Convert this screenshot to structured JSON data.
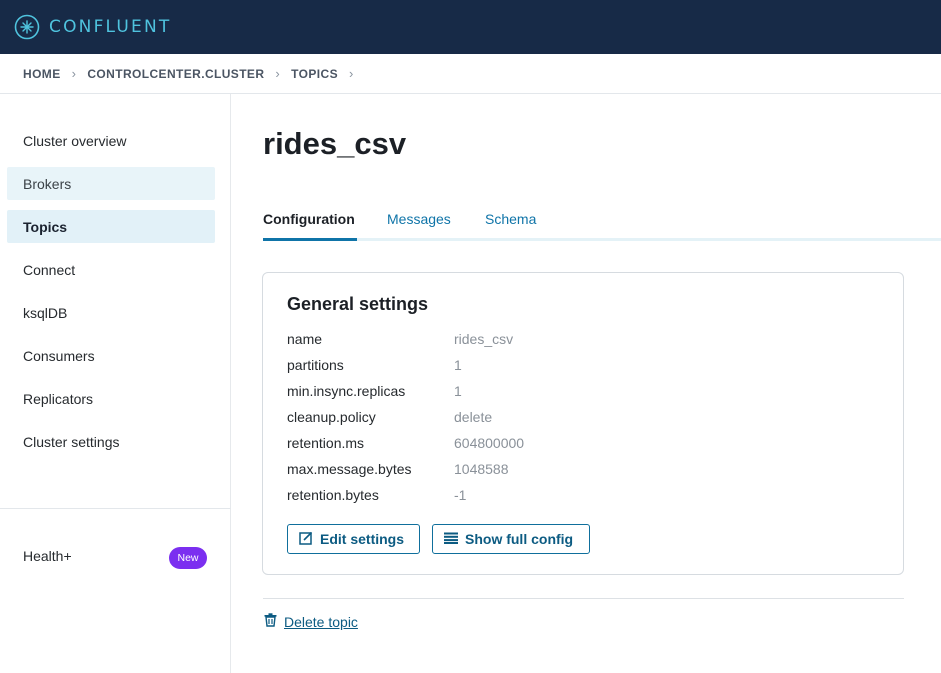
{
  "brand": {
    "name": "CONFLUENT",
    "accent": "#4fc3de",
    "bar_color": "#172a47"
  },
  "breadcrumb": [
    "HOME",
    "CONTROLCENTER.CLUSTER",
    "TOPICS"
  ],
  "sidebar": {
    "items": [
      {
        "label": "Cluster overview"
      },
      {
        "label": "Brokers"
      },
      {
        "label": "Topics"
      },
      {
        "label": "Connect"
      },
      {
        "label": "ksqlDB"
      },
      {
        "label": "Consumers"
      },
      {
        "label": "Replicators"
      },
      {
        "label": "Cluster settings"
      }
    ],
    "health_label": "Health+",
    "health_badge": "New"
  },
  "topic": {
    "title": "rides_csv"
  },
  "tabs": [
    {
      "label": "Configuration"
    },
    {
      "label": "Messages"
    },
    {
      "label": "Schema"
    }
  ],
  "settings": {
    "title": "General settings",
    "rows": [
      {
        "key": "name",
        "value": "rides_csv"
      },
      {
        "key": "partitions",
        "value": "1"
      },
      {
        "key": "min.insync.replicas",
        "value": "1"
      },
      {
        "key": "cleanup.policy",
        "value": "delete"
      },
      {
        "key": "retention.ms",
        "value": "604800000"
      },
      {
        "key": "max.message.bytes",
        "value": "1048588"
      },
      {
        "key": "retention.bytes",
        "value": "-1"
      }
    ],
    "edit_label": "Edit settings",
    "show_label": "Show full config"
  },
  "delete_label": "Delete topic",
  "icons": {
    "logo": "confluent-logo-icon",
    "edit": "edit-icon",
    "list": "list-icon",
    "trash": "trash-icon",
    "chevron": "chevron-right-icon"
  }
}
